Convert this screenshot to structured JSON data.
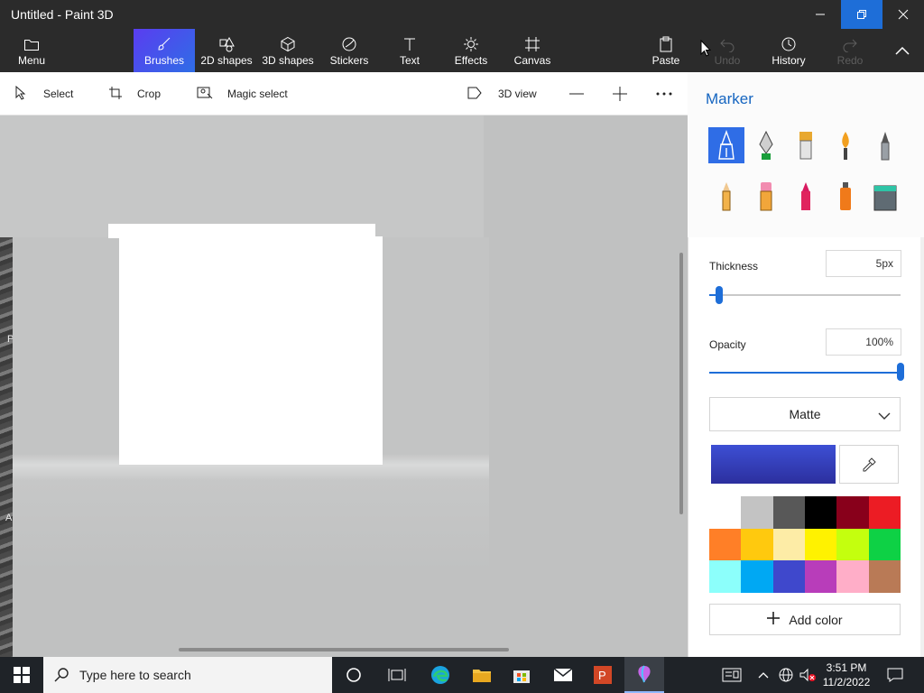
{
  "window": {
    "title": "Untitled - Paint 3D"
  },
  "ribbon": {
    "menu": "Menu",
    "brushes": "Brushes",
    "shapes2d": "2D shapes",
    "shapes3d": "3D shapes",
    "stickers": "Stickers",
    "text": "Text",
    "effects": "Effects",
    "canvas": "Canvas",
    "paste": "Paste",
    "undo": "Undo",
    "history": "History",
    "redo": "Redo"
  },
  "subbar": {
    "select": "Select",
    "crop": "Crop",
    "magic_select": "Magic select",
    "view3d": "3D view"
  },
  "panel": {
    "title": "Marker",
    "thickness_label": "Thickness",
    "thickness_value": "5px",
    "thickness_level": 0.05,
    "opacity_label": "Opacity",
    "opacity_value": "100%",
    "opacity_level": 1.0,
    "finish": "Matte",
    "add_color": "Add color",
    "current_color": "#3d4fd4",
    "palette": [
      "#ffffff",
      "#c3c3c3",
      "#585858",
      "#000000",
      "#88001b",
      "#ec1c24",
      "#ff7f27",
      "#ffc90e",
      "#fdeca6",
      "#fff200",
      "#c4ff0e",
      "#0ed145",
      "#8cfffb",
      "#00a8f3",
      "#3f48cc",
      "#b83dba",
      "#ffaec8",
      "#b97a56"
    ]
  },
  "taskbar": {
    "search_placeholder": "Type here to search",
    "time": "3:51 PM",
    "date": "11/2/2022"
  },
  "desktop_edge": {
    "top_letter": "P",
    "bottom_letter": "A"
  }
}
